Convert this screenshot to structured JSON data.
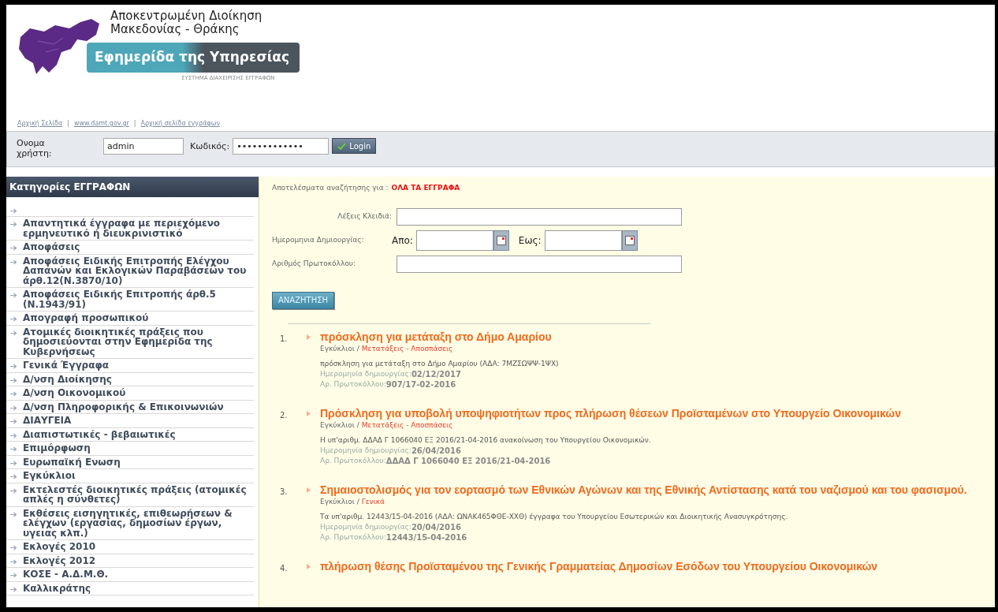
{
  "header": {
    "org_lines": [
      "Αποκεντρωμένη Διοίκηση",
      "Μακεδονίας - Θράκης"
    ],
    "banner": "Εφημερίδα της Υπηρεσίας",
    "subtitle": "ΣΥΣΤΗΜΑ ΔΙΑΧΕΙΡΙΣΗΣ ΕΓΓΡΑΦΩΝ"
  },
  "links": [
    "Αρχική Σελίδα",
    "www.damt.gov.gr",
    "Αρχική σελίδα εγγράφων"
  ],
  "link_separator": "|",
  "login": {
    "username_label": "Ονομα χρήστη:",
    "username": "admin",
    "password_label": "Κωδικός:",
    "password": "•••••••••••••",
    "button": "Login"
  },
  "sidebar": {
    "title": "Κατηγορίες ΕΓΓΡΑΦΩΝ",
    "items": [
      {
        "kind": "empty"
      },
      {
        "label": "Απαντητικά έγγραφα με περιεχόμενο ερμηνευτικό ή διευκρινιστικό"
      },
      {
        "label": "Αποφάσεις"
      },
      {
        "label": "Αποφάσεις Ειδικής Επιτροπής Ελέγχου Δαπανών και Εκλογικών Παραβάσεων του άρθ.12(Ν.3870/10)"
      },
      {
        "label": "Αποφάσεις Ειδικής Επιτροπής άρθ.5 (Ν.1943/91)"
      },
      {
        "label": "Απογραφή προσωπικού"
      },
      {
        "label": "Ατομικές διοικητικές πράξεις που δημοσιεύονται στην Εφημερίδα της Κυβερνήσεως"
      },
      {
        "label": "Γενικά Έγγραφα"
      },
      {
        "label": "Δ/νση Διοίκησης"
      },
      {
        "label": "Δ/νση Οικονομικού"
      },
      {
        "label": "Δ/νση Πληροφορικής & Επικοινωνιών"
      },
      {
        "label": "ΔΙΑΥΓΕΙΑ"
      },
      {
        "label": "Διαπιστωτικές - βεβαιωτικές"
      },
      {
        "label": "Επιμόρφωση"
      },
      {
        "label": "Ευρωπαϊκή Ενωση"
      },
      {
        "label": "Εγκύκλιοι"
      },
      {
        "label": "Εκτελεστές διοικητικές πράξεις (ατομικές απλές η σύνθετες)"
      },
      {
        "label": "Εκθέσεις εισηγητικές, επιθεωρήσεων & ελέγχων (εργασίας, δημοσίων έργων, υγειας κλπ.)"
      },
      {
        "label": "Εκλογές 2010"
      },
      {
        "label": "Εκλογές 2012"
      },
      {
        "label": "ΚΟΣΕ - Α.Δ.Μ.Θ."
      },
      {
        "label": "Καλλικράτης"
      }
    ]
  },
  "search": {
    "results_label": "Αποτελέσματα αναζήτησης για :",
    "results_value": "ΟΛΑ ΤΑ ΕΓΓΡΑΦΑ",
    "keywords_label": "Λέξεις Κλειδιά:",
    "date_label": "Ημερομηνια Δημιουργίας:",
    "from_label": "Απο:",
    "to_label": "Εως:",
    "protocol_label": "Αριθμός Πρωτοκόλλου:",
    "button": "ΑΝΑΖΗΤΗΣΗ"
  },
  "results": [
    {
      "number": "1.",
      "title": "πρόσκληση για μετάταξη στο Δήμο Αμαρίου",
      "category": "Εγκύκλιοι",
      "subcategory": "Μετατάξεις - Αποσπάσεις",
      "description": "πρόσκληση για μετάταξη στο Δήμο Αμαρίου (ΑΔΑ: 7ΜΖΣΩΨΨ-1ΨΧ)",
      "date_label": "Ημερομηνία δημιουργίας:",
      "date": "02/12/2017",
      "protocol_label": "Αρ. Πρωτοκόλλου:",
      "protocol": "907/17-02-2016"
    },
    {
      "number": "2.",
      "title": "Πρόσκληση για υποβολή υποψηφιοτήτων προς πλήρωση θέσεων Προϊσταμένων στο Υπουργείο Οικονομικών",
      "category": "Εγκύκλιοι",
      "subcategory": "Μετατάξεις - Αποσπάσεις",
      "description": "Η υπ'αριθμ. ΔΔΑΔ Γ 1066040 ΕΞ 2016/21-04-2016 ανακοίνωση του Υπουργείου Οικονομικών.",
      "date_label": "Ημερομηνία δημιουργίας:",
      "date": "26/04/2016",
      "protocol_label": "Αρ. Πρωτοκόλλου:",
      "protocol": "ΔΔΑΔ Γ 1066040 ΕΞ 2016/21-04-2016"
    },
    {
      "number": "3.",
      "title": "Σημαιοστολισμός για τον εορτασμό των Εθνικών Αγώνων και της Εθνικής Αντίστασης κατά του ναζισμού και του φασισμού.",
      "category": "Εγκύκλιοι",
      "subcategory": "Γενικά",
      "description": "Τα υπ'αριθμ. 12443/15-04-2016 (ΑΔΑ: ΩΝΑΚ465ΦΘΕ-ΧΧΘ) έγγραφα του Υπουργείου Εσωτερικών και Διοικητικής Ανασυγκρότησης.",
      "date_label": "Ημερομηνία δημιουργίας:",
      "date": "20/04/2016",
      "protocol_label": "Αρ. Πρωτοκόλλου:",
      "protocol": "12443/15-04-2016"
    },
    {
      "number": "4.",
      "title": "πλήρωση θέσης Προϊσταμένου της Γενικής Γραμματείας Δημοσίων Εσόδων του Υπουργείου Οικονομικών"
    }
  ],
  "category_separator": "/"
}
